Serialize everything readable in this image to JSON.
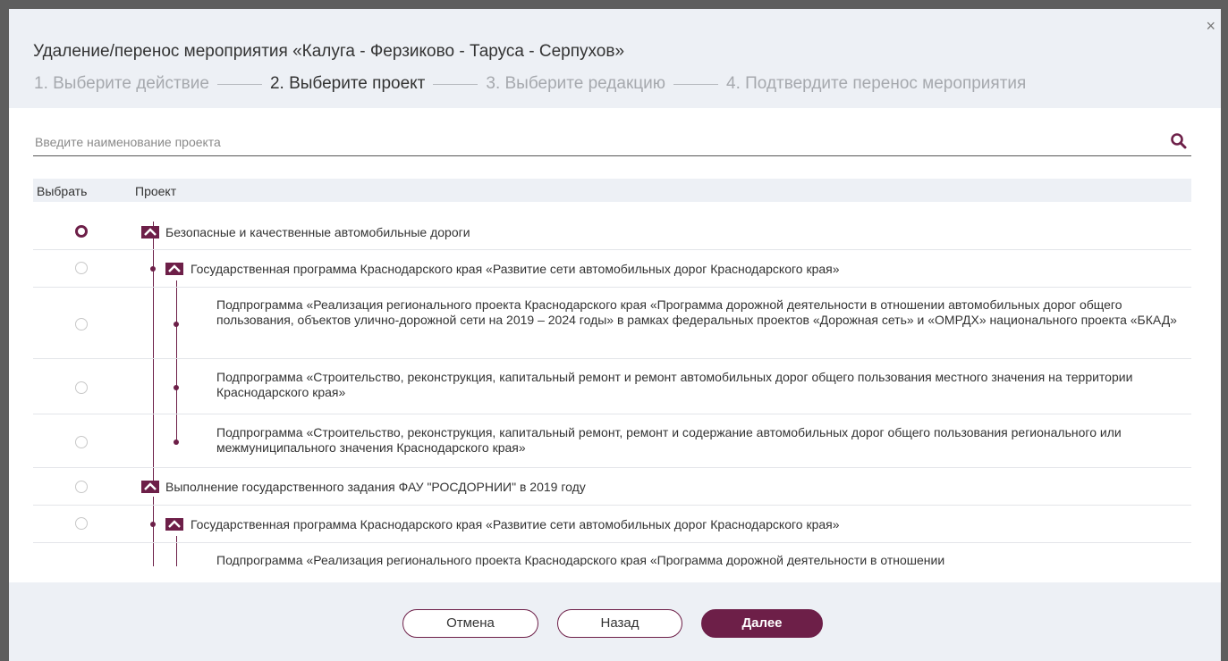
{
  "modal": {
    "close_label": "×",
    "title": "Удаление/перенос мероприятия «Калуга - Ферзиково - Таруса - Серпухов»",
    "steps": [
      {
        "label": "1. Выберите действие",
        "active": false
      },
      {
        "label": "2. Выберите проект",
        "active": true
      },
      {
        "label": "3. Выберите редакцию",
        "active": false
      },
      {
        "label": "4. Подтвердите перенос мероприятия",
        "active": false
      }
    ]
  },
  "search": {
    "placeholder": "Введите наименование проекта",
    "value": ""
  },
  "table": {
    "col_select": "Выбрать",
    "col_project": "Проект",
    "rows": [
      {
        "level": 0,
        "checked": true,
        "text": "Безопасные и качественные автомобильные дороги"
      },
      {
        "level": 1,
        "checked": false,
        "text": "Государственная программа Краснодарского края «Развитие сети автомобильных дорог Краснодарского края»"
      },
      {
        "level": 2,
        "checked": false,
        "text": "Подпрограмма «Реализация регионального проекта Краснодарского края «Программа дорожной деятельности в отношении автомобильных дорог общего пользования, объектов улично-дорожной сети на 2019 – 2024 годы» в рамках федеральных проектов «Дорожная сеть» и «ОМРДХ» национального проекта «БКАД»"
      },
      {
        "level": 2,
        "checked": false,
        "text": "Подпрограмма «Строительство, реконструкция, капитальный ремонт и ремонт автомобильных дорог общего пользования местного значения на территории Краснодарского края»"
      },
      {
        "level": 2,
        "checked": false,
        "text": "Подпрограмма «Строительство, реконструкция, капитальный ремонт, ремонт и содержание автомобильных дорог общего пользования регионального или межмуниципального значения Краснодарского края»"
      },
      {
        "level": 0,
        "checked": false,
        "text": "Выполнение государственного задания ФАУ \"РОСДОРНИИ\" в 2019 году"
      },
      {
        "level": 1,
        "checked": false,
        "text": "Государственная программа Краснодарского края «Развитие сети автомобильных дорог Краснодарского края»"
      },
      {
        "level": 2,
        "checked": false,
        "text": "Подпрограмма «Реализация регионального проекта Краснодарского края «Программа дорожной деятельности в отношении"
      }
    ]
  },
  "footer": {
    "cancel_label": "Отмена",
    "back_label": "Назад",
    "next_label": "Далее"
  },
  "colors": {
    "accent": "#6d1f48",
    "header_bg": "#edf0f5"
  },
  "icons": {
    "search": "search-icon",
    "close": "close-icon",
    "collapse": "chevron-up-icon"
  }
}
